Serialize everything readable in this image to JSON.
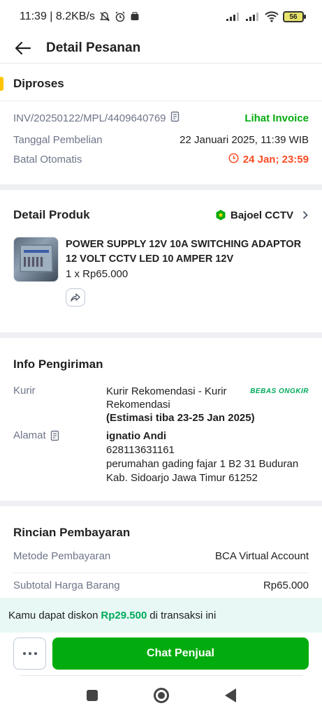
{
  "status_bar": {
    "time_net": "11:39 | 8.2KB/s",
    "battery": "56"
  },
  "header": {
    "title": "Detail Pesanan"
  },
  "order_status": {
    "label": "Diproses",
    "accent_color": "#ffc400"
  },
  "invoice": {
    "number": "INV/20250122/MPL/4409640769",
    "link_label": "Lihat Invoice",
    "purchase_date_label": "Tanggal Pembelian",
    "purchase_date_value": "22 Januari 2025, 11:39 WIB",
    "auto_cancel_label": "Batal Otomatis",
    "auto_cancel_value": "24 Jan; 23:59"
  },
  "product": {
    "section_title": "Detail Produk",
    "shop_name": "Bajoel CCTV",
    "name": "POWER SUPPLY 12V 10A SWITCHING ADAPTOR 12 VOLT CCTV LED 10 AMPER 12V",
    "qty_price": "1 x Rp65.000"
  },
  "shipping": {
    "section_title": "Info Pengiriman",
    "courier_label": "Kurir",
    "courier_value": "Kurir Rekomendasi - Kurir Rekomendasi",
    "courier_estimate": "(Estimasi tiba 23-25 Jan 2025)",
    "free_shipping_badge": "BEBAS ONGKIR",
    "address_label": "Alamat",
    "recipient_name": "ignatio Andi",
    "recipient_phone": "628113631161",
    "address_line1": "perumahan gading fajar 1 B2 31 Buduran",
    "address_line2": "Kab. Sidoarjo Jawa Timur 61252"
  },
  "payment": {
    "section_title": "Rincian Pembayaran",
    "method_label": "Metode Pembayaran",
    "method_value": "BCA Virtual Account",
    "subtotal_label": "Subtotal Harga Barang",
    "subtotal_value": "Rp65.000"
  },
  "promo": {
    "prefix": "Kamu dapat diskon",
    "amount": "Rp29.500",
    "suffix": "di transaksi ini"
  },
  "footer": {
    "chat_label": "Chat Penjual"
  },
  "colors": {
    "primary_green": "#03ac0e",
    "deadline_orange": "#f94d24"
  }
}
